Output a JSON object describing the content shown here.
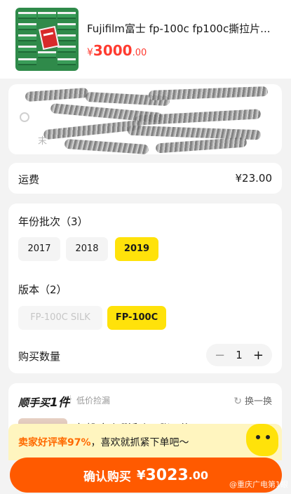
{
  "product": {
    "title": "Fujifilm富士 fp-100c fp100c撕拉片...",
    "price_currency": "¥",
    "price_int": "3000",
    "price_dec": ".00"
  },
  "address": {
    "partial_char": "末"
  },
  "shipping": {
    "label": "运费",
    "value": "¥23.00"
  },
  "options": {
    "year_title": "年份批次（3）",
    "years": [
      "2017",
      "2018",
      "2019"
    ],
    "selected_year": "2019",
    "version_title": "版本（2）",
    "versions": [
      "FP-100C SILK",
      "FP-100C"
    ],
    "selected_version": "FP-100C",
    "quantity_label": "购买数量",
    "quantity": "1",
    "minus": "−",
    "plus": "+"
  },
  "addon": {
    "title_prefix": "顺手买",
    "title_big": "1件",
    "subtitle": "低价捡漏",
    "refresh_label": "换一换",
    "item_text": "包邮 文晓珊活动62张，共1.43G"
  },
  "banner": {
    "highlight": "卖家好评率97%",
    "message": "，喜欢就抓紧下单吧～"
  },
  "confirm": {
    "label": "确认购买",
    "currency": "¥",
    "amount_int": "3023",
    "amount_dec": ".00"
  },
  "watermark": "@重庆广电第1眼",
  "colors": {
    "accent_orange": "#ff5a00",
    "price_red": "#ff3b30",
    "selected_yellow": "#ffe20a",
    "banner_bg": "#fff5bf"
  }
}
